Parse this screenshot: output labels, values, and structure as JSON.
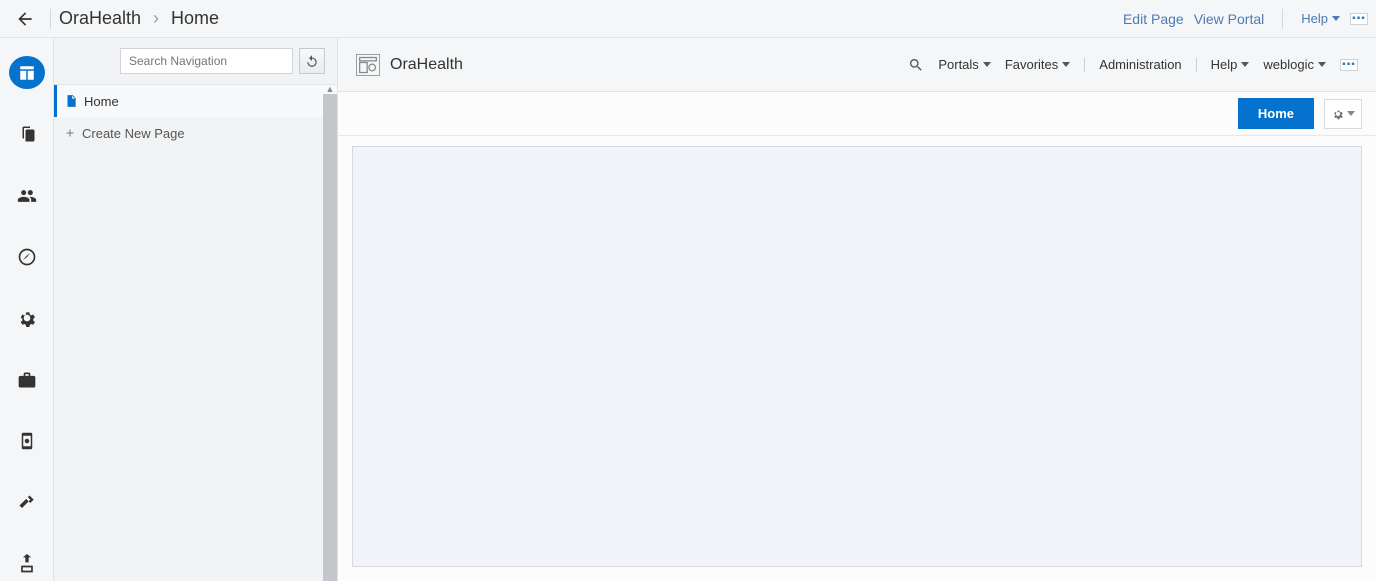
{
  "header": {
    "breadcrumb_root": "OraHealth",
    "breadcrumb_sep": "›",
    "breadcrumb_current": "Home",
    "edit_page": "Edit Page",
    "view_portal": "View Portal",
    "help": "Help"
  },
  "nav": {
    "search_placeholder": "Search Navigation",
    "items": [
      {
        "label": "Home"
      }
    ],
    "create_label": "Create New Page"
  },
  "portal": {
    "title": "OraHealth",
    "menus": {
      "portals": "Portals",
      "favorites": "Favorites",
      "administration": "Administration",
      "help": "Help",
      "user": "weblogic"
    }
  },
  "tabs": {
    "home": "Home"
  }
}
